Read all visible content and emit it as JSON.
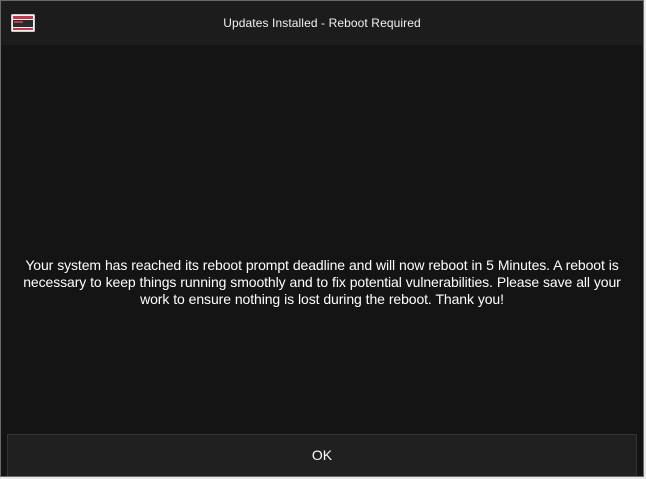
{
  "window": {
    "title": "Updates Installed - Reboot Required",
    "icon": "monitor-icon"
  },
  "message": {
    "text": "Your system has reached its reboot prompt deadline and will now reboot in 5 Minutes. A reboot is necessary to keep things running smoothly and to fix potential vulnerabilities. Please save all your work to ensure nothing is lost during the reboot.  Thank you!"
  },
  "buttons": {
    "ok_label": "OK"
  },
  "colors": {
    "background": "#141414",
    "titlebar": "#1c1c1c",
    "text": "#ffffff",
    "icon_accent": "#c23a4a"
  }
}
